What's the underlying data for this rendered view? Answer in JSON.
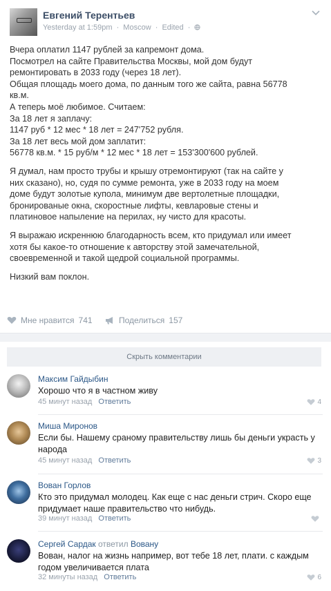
{
  "post": {
    "author": "Евгений Терентьев",
    "meta": [
      "Yesterday at 1:59pm",
      "·",
      "Moscow",
      "·",
      "Edited",
      "·"
    ],
    "paragraphs": [
      [
        "Вчера оплатил 1147 рублей за капремонт дома.",
        "Посмотрел на сайте Правительства Москвы, мой дом будут",
        "ремонтировать в 2033 году (через 18 лет).",
        "Общая площадь моего дома, по данным того же сайта, равна 56778",
        "кв.м.",
        "А теперь моё любимое. Считаем:",
        "За 18 лет я заплачу:",
        "1147 руб * 12 мес * 18 лет = 247'752 рубля.",
        "За 18 лет весь мой дом заплатит:",
        "56778 кв.м. * 15 руб/м * 12 мес * 18 лет = 153'300'600 рублей."
      ],
      [
        "Я думал, нам просто трубы и крышу отремонтируют (так на сайте у",
        "них сказано), но, судя по сумме ремонта, уже в 2033 году на моем",
        "доме будут золотые купола, минимум две вертолетные площадки,",
        "бронированые окна, скоростные лифты, кевларовые стены и",
        "платиновое напыление на перилах, ну чисто для красоты."
      ],
      [
        "Я выражаю искреннюю благодарность всем, кто придумал или имеет",
        "хотя бы какое-то отношение к авторству этой замечательной,",
        "своевременной и такой щедрой социальной программы."
      ],
      [
        "Низкий вам поклон."
      ]
    ],
    "likes_label": "Мне нравится",
    "likes_count": "741",
    "share_label": "Поделиться",
    "share_count": "157"
  },
  "hide_comments_label": "Скрыть комментарии",
  "comments": [
    {
      "name": "Максим Гайдыбин",
      "reply_word": "",
      "reply_to": "",
      "lines": [
        "Хорошо что я в частном живу"
      ],
      "time": "45 минут назад",
      "answer": "Ответить",
      "likes": "4"
    },
    {
      "name": "Миша Миронов",
      "reply_word": "",
      "reply_to": "",
      "lines": [
        "Если бы. Нашему сраному правительству лишь бы деньги украсть у",
        "народа"
      ],
      "time": "45 минут назад",
      "answer": "Ответить",
      "likes": "3"
    },
    {
      "name": "Вован Горлов",
      "reply_word": "",
      "reply_to": "",
      "lines": [
        "Кто это придумал молодец. Как еще с нас деньги стрич. Скоро еще",
        "придумает наше правительство что нибудь."
      ],
      "time": "39 минут назад",
      "answer": "Ответить",
      "likes": ""
    },
    {
      "name": "Сергей Сардак",
      "reply_word": "ответил",
      "reply_to": "Вовану",
      "lines": [
        "Вован, налог на жизнь например, вот тебе 18 лет, плати. с каждым",
        "годом увеличивается плата"
      ],
      "time": "32 минуты назад",
      "answer": "Ответить",
      "likes": "6"
    }
  ],
  "icons": {
    "heart": "heart-icon",
    "megaphone": "megaphone-icon",
    "globe": "globe-icon",
    "chevron": "chevron-down-icon"
  },
  "colors": {
    "author": "#3b4d66",
    "link": "#2b5787",
    "muted": "#9aa3ad",
    "button_bg": "#eef0f3"
  }
}
